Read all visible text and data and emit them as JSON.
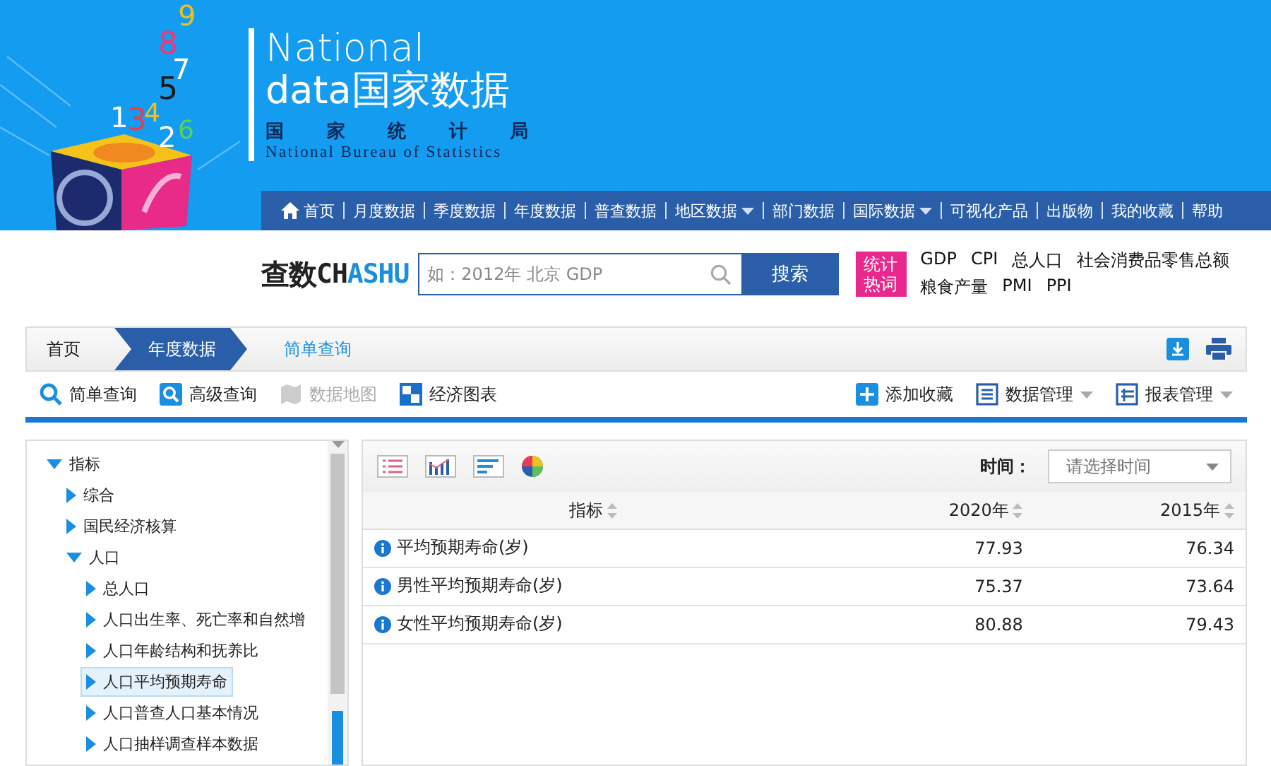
{
  "logo": {
    "digits": [
      "9",
      "8",
      "7",
      "5",
      "1",
      "3",
      "4",
      "2",
      "6"
    ],
    "title_line1": "National",
    "title_line2_latin": "data",
    "title_line2_cn": "国家数据",
    "org_cn": [
      "国",
      "家",
      "统",
      "计",
      "局"
    ],
    "org_en": "National Bureau of Statistics"
  },
  "nav": [
    {
      "label": "首页",
      "kind": "home"
    },
    {
      "label": "月度数据",
      "kind": "plain"
    },
    {
      "label": "季度数据",
      "kind": "plain"
    },
    {
      "label": "年度数据",
      "kind": "plain"
    },
    {
      "label": "普查数据",
      "kind": "plain"
    },
    {
      "label": "地区数据",
      "kind": "dropdown"
    },
    {
      "label": "部门数据",
      "kind": "plain"
    },
    {
      "label": "国际数据",
      "kind": "dropdown"
    },
    {
      "label": "可视化产品",
      "kind": "plain"
    },
    {
      "label": "出版物",
      "kind": "plain"
    },
    {
      "label": "我的收藏",
      "kind": "plain"
    },
    {
      "label": "帮助",
      "kind": "plain"
    }
  ],
  "search": {
    "brand_cn": "查数",
    "brand_en_a": "CH",
    "brand_en_b": "A",
    "brand_en_c": "SHU",
    "placeholder": "如：2012年 北京 GDP",
    "button": "搜索",
    "hot_label": [
      "统计",
      "热词"
    ],
    "hot_words": [
      [
        "GDP",
        "CPI",
        "总人口",
        "社会消费品零售总额"
      ],
      [
        "粮食产量",
        "PMI",
        "PPI"
      ]
    ]
  },
  "breadcrumb": [
    {
      "label": "首页",
      "selected": false
    },
    {
      "label": "年度数据",
      "selected": true
    },
    {
      "label": "简单查询",
      "selected": false
    }
  ],
  "tools_left": [
    {
      "label": "简单查询",
      "kind": "search",
      "disabled": false
    },
    {
      "label": "高级查询",
      "kind": "advanced",
      "disabled": false
    },
    {
      "label": "数据地图",
      "kind": "map",
      "disabled": true
    },
    {
      "label": "经济图表",
      "kind": "chart",
      "disabled": false
    }
  ],
  "tools_right": [
    {
      "label": "添加收藏",
      "kind": "plus"
    },
    {
      "label": "数据管理",
      "kind": "list"
    },
    {
      "label": "报表管理",
      "kind": "grid"
    }
  ],
  "tree": [
    {
      "label": "指标",
      "expanded": true,
      "selected": false,
      "children": [
        {
          "label": "综合",
          "expanded": false,
          "selected": false
        },
        {
          "label": "国民经济核算",
          "expanded": false,
          "selected": false
        },
        {
          "label": "人口",
          "expanded": true,
          "selected": false,
          "children": [
            {
              "label": "总人口",
              "expanded": false,
              "selected": false
            },
            {
              "label": "人口出生率、死亡率和自然增",
              "expanded": false,
              "selected": false
            },
            {
              "label": "人口年龄结构和抚养比",
              "expanded": false,
              "selected": false
            },
            {
              "label": "人口平均预期寿命",
              "expanded": false,
              "selected": true
            },
            {
              "label": "人口普查人口基本情况",
              "expanded": false,
              "selected": false
            },
            {
              "label": "人口抽样调查样本数据",
              "expanded": false,
              "selected": false
            }
          ]
        }
      ]
    }
  ],
  "table": {
    "time_label": "时间：",
    "time_placeholder": "请选择时间",
    "columns": [
      "指标",
      "2020年",
      "2015年"
    ],
    "rows": [
      {
        "name": "平均预期寿命(岁)",
        "values": [
          "77.93",
          "76.34"
        ]
      },
      {
        "name": "男性平均预期寿命(岁)",
        "values": [
          "75.37",
          "73.64"
        ]
      },
      {
        "name": "女性平均预期寿命(岁)",
        "values": [
          "80.88",
          "79.43"
        ]
      }
    ]
  }
}
